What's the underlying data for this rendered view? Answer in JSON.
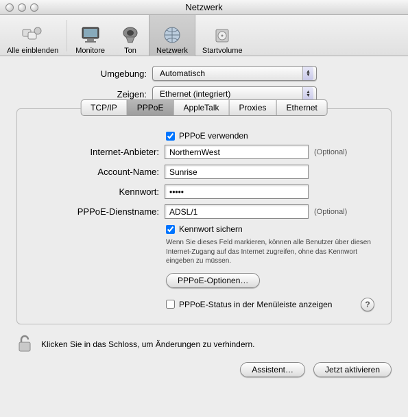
{
  "window": {
    "title": "Netzwerk"
  },
  "toolbar": {
    "items": [
      {
        "label": "Alle einblenden"
      },
      {
        "label": "Monitore"
      },
      {
        "label": "Ton"
      },
      {
        "label": "Netzwerk"
      },
      {
        "label": "Startvolume"
      }
    ]
  },
  "selectors": {
    "location_label": "Umgebung:",
    "location_value": "Automatisch",
    "show_label": "Zeigen:",
    "show_value": "Ethernet (integriert)"
  },
  "tabs": {
    "tcpip": "TCP/IP",
    "pppoe": "PPPoE",
    "appletalk": "AppleTalk",
    "proxies": "Proxies",
    "ethernet": "Ethernet"
  },
  "form": {
    "use_pppoe": "PPPoE verwenden",
    "provider_label": "Internet-Anbieter:",
    "provider_value": "NorthernWest",
    "account_label": "Account-Name:",
    "account_value": "Sunrise",
    "password_label": "Kennwort:",
    "password_value": "•••••",
    "service_label": "PPPoE-Dienstname:",
    "service_value": "ADSL/1",
    "optional": "(Optional)",
    "save_password": "Kennwort sichern",
    "save_password_note": "Wenn Sie dieses Feld markieren, können alle Benutzer über diesen Internet-Zugang auf das Internet zugreifen, ohne das Kennwort eingeben zu müssen.",
    "options_button": "PPPoE-Optionen…",
    "status_menu": "PPPoE-Status in der Menüleiste anzeigen",
    "help": "?"
  },
  "lock": {
    "text": "Klicken Sie in das Schloss, um Änderungen zu verhindern."
  },
  "footer": {
    "assist": "Assistent…",
    "apply": "Jetzt aktivieren"
  }
}
